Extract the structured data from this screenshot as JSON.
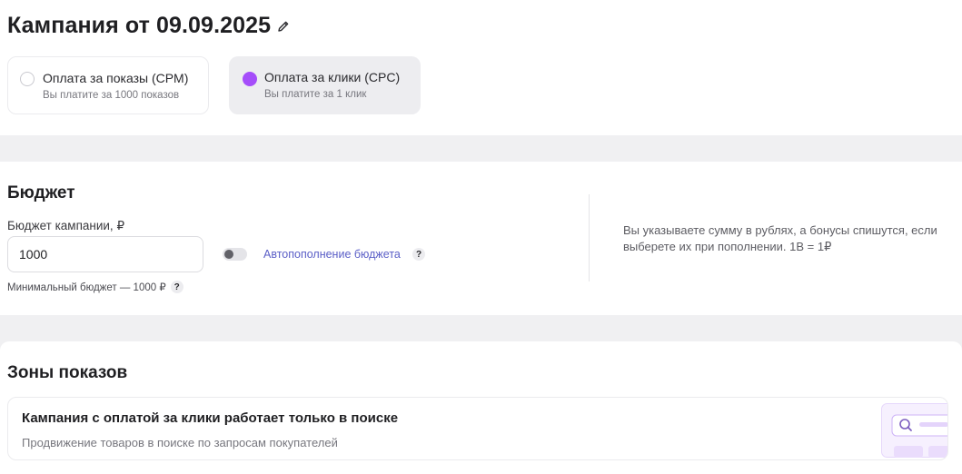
{
  "header": {
    "title": "Кампания от 09.09.2025"
  },
  "payment": {
    "options": [
      {
        "title": "Оплата за показы (CPM)",
        "subtitle": "Вы платите за 1000 показов",
        "selected": false
      },
      {
        "title": "Оплата за клики (CPC)",
        "subtitle": "Вы платите за 1 клик",
        "selected": true
      }
    ]
  },
  "budget": {
    "title": "Бюджет",
    "field_label": "Бюджет кампании, ₽",
    "value": "1000",
    "min_note": "Минимальный бюджет — 1000 ₽",
    "autofill_label": "Автопополнение бюджета",
    "autofill_enabled": false,
    "help_mark": "?",
    "note": "Вы указываете сумму в рублях, а бонусы спишутся, если выберете их при пополнении. 1В = 1₽"
  },
  "zones": {
    "title": "Зоны показов",
    "card_title": "Кампания с оплатой за клики работает только в поиске",
    "card_subtitle": "Продвижение товаров в поиске по запросам покупателей"
  },
  "colors": {
    "accent": "#a54dfa",
    "link": "#5b5fc7",
    "background": "#f0f0f2"
  },
  "icons": [
    "pencil-icon",
    "question-icon",
    "search-icon"
  ]
}
